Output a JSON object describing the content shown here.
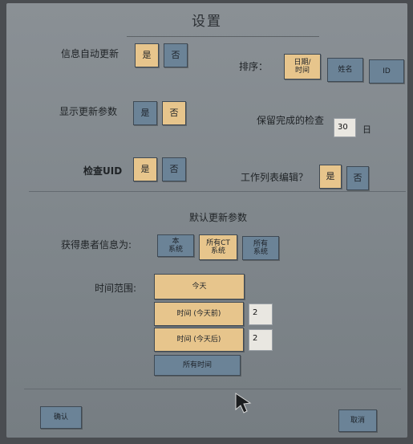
{
  "title": "设置",
  "auto_update": {
    "label": "信息自动更新",
    "yes": "是",
    "no": "否"
  },
  "sort": {
    "label": "排序：",
    "date_time": "日期/\n时间",
    "name": "姓名",
    "id": "ID"
  },
  "show_params": {
    "label": "显示更新参数",
    "yes": "是",
    "no": "否"
  },
  "keep_done": {
    "label": "保留完成的检查",
    "value": "30",
    "unit": "日"
  },
  "check_uid": {
    "label": "检查UID",
    "yes": "是",
    "no": "否"
  },
  "worklist_edit": {
    "label": "工作列表编辑？",
    "yes": "是",
    "no": "否"
  },
  "defaults": {
    "heading": "默认更新参数",
    "get_patient_label": "获得患者信息为:",
    "this_system": "本\n系统",
    "all_ct": "所有CT\n系统",
    "all_systems": "所有\n系统",
    "time_range_label": "时间范围:",
    "today": "今天",
    "before_today": "时间 (今天前)",
    "before_value": "2",
    "after_today": "时间 (今天后)",
    "after_value": "2",
    "all_time": "所有时间"
  },
  "footer": {
    "confirm": "确认",
    "cancel": "取消"
  },
  "colors": {
    "selected": "#e7c58c",
    "unselected": "#6b8397",
    "panel": "#8a9095"
  }
}
